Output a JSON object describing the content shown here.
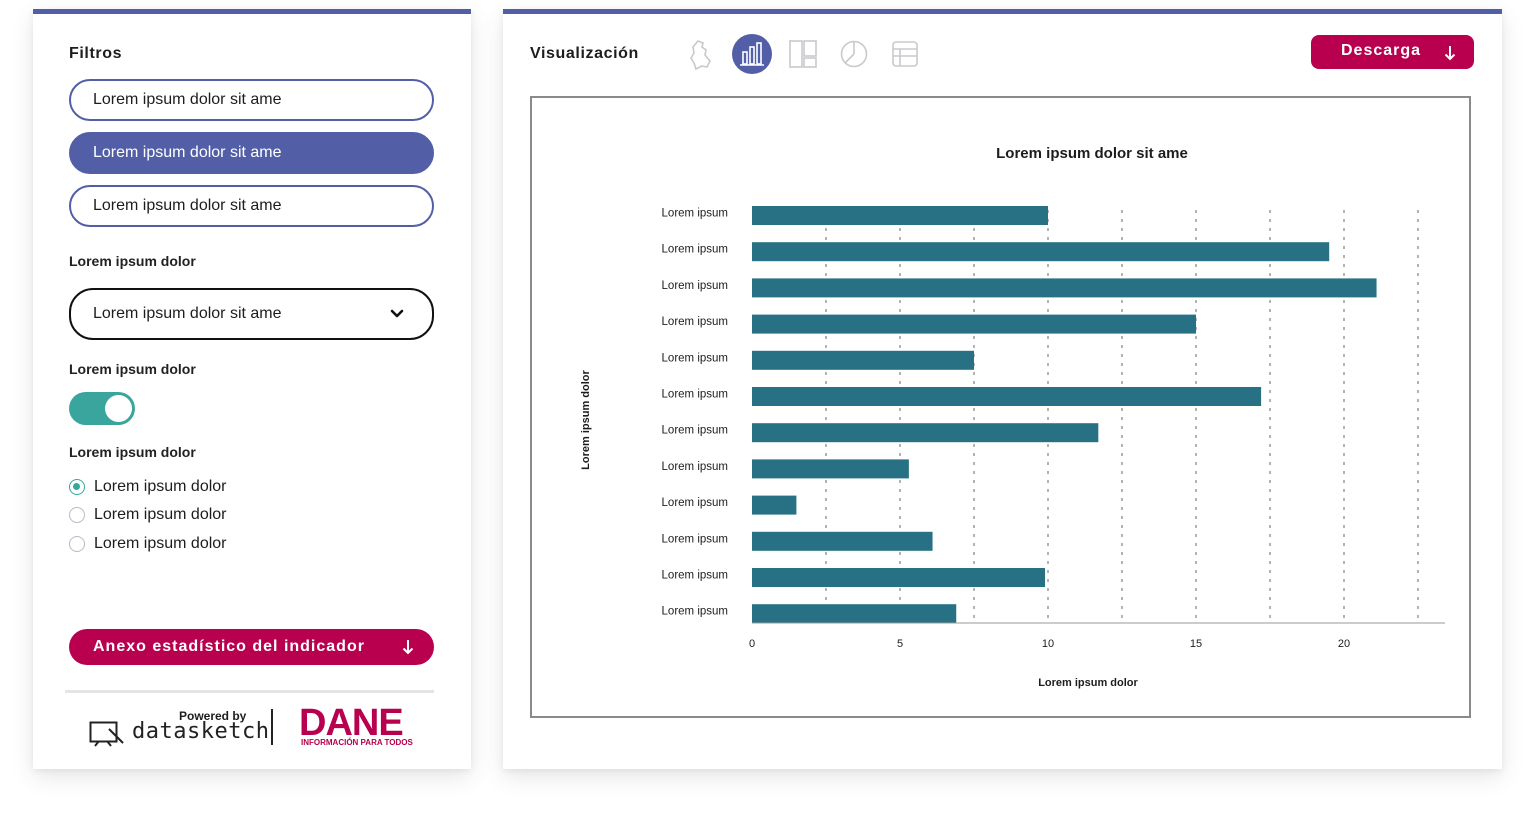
{
  "filters": {
    "title": "Filtros",
    "pills": [
      {
        "label": "Lorem ipsum dolor sit ame",
        "active": false
      },
      {
        "label": "Lorem ipsum dolor sit ame",
        "active": true
      },
      {
        "label": "Lorem ipsum dolor sit ame",
        "active": false
      }
    ],
    "select_label": "Lorem ipsum dolor",
    "select_value": "Lorem ipsum dolor sit ame",
    "toggle_label": "Lorem ipsum dolor",
    "toggle_on": true,
    "radio_label": "Lorem ipsum dolor",
    "radios": [
      {
        "label": "Lorem ipsum dolor",
        "checked": true
      },
      {
        "label": "Lorem ipsum dolor",
        "checked": false
      },
      {
        "label": "Lorem ipsum dolor",
        "checked": false
      }
    ],
    "annex_button": "Anexo estadístico del indicador"
  },
  "footer": {
    "powered_by": "Powered by",
    "brand": "datasketch",
    "partner": "DANE",
    "partner_tagline": "INFORMACIÓN PARA TODOS"
  },
  "visualization": {
    "title": "Visualización",
    "download_button": "Descarga",
    "view_icons": [
      {
        "name": "map-icon",
        "active": false
      },
      {
        "name": "bar-chart-icon",
        "active": true
      },
      {
        "name": "treemap-icon",
        "active": false
      },
      {
        "name": "pie-chart-icon",
        "active": false
      },
      {
        "name": "table-icon",
        "active": false
      }
    ]
  },
  "colors": {
    "accent_blue": "#525fa6",
    "brand_red": "#b8004f",
    "teal": "#3aa59d",
    "bar": "#287184"
  },
  "chart_data": {
    "type": "bar",
    "orientation": "horizontal",
    "title": "Lorem ipsum dolor sit ame",
    "xlabel": "Lorem ipsum dolor",
    "ylabel": "Lorem ipsum dolor",
    "categories": [
      "Lorem ipsum",
      "Lorem ipsum",
      "Lorem ipsum",
      "Lorem ipsum",
      "Lorem ipsum",
      "Lorem ipsum",
      "Lorem ipsum",
      "Lorem ipsum",
      "Lorem ipsum",
      "Lorem ipsum",
      "Lorem ipsum",
      "Lorem ipsum"
    ],
    "values": [
      10,
      19.5,
      21.1,
      15,
      7.5,
      17.2,
      11.7,
      5.3,
      1.5,
      6.1,
      9.9,
      6.9
    ],
    "xticks": [
      "0",
      "5",
      "10",
      "15",
      "20"
    ],
    "xlim": [
      0,
      23
    ],
    "grid": "vertical dashed"
  }
}
